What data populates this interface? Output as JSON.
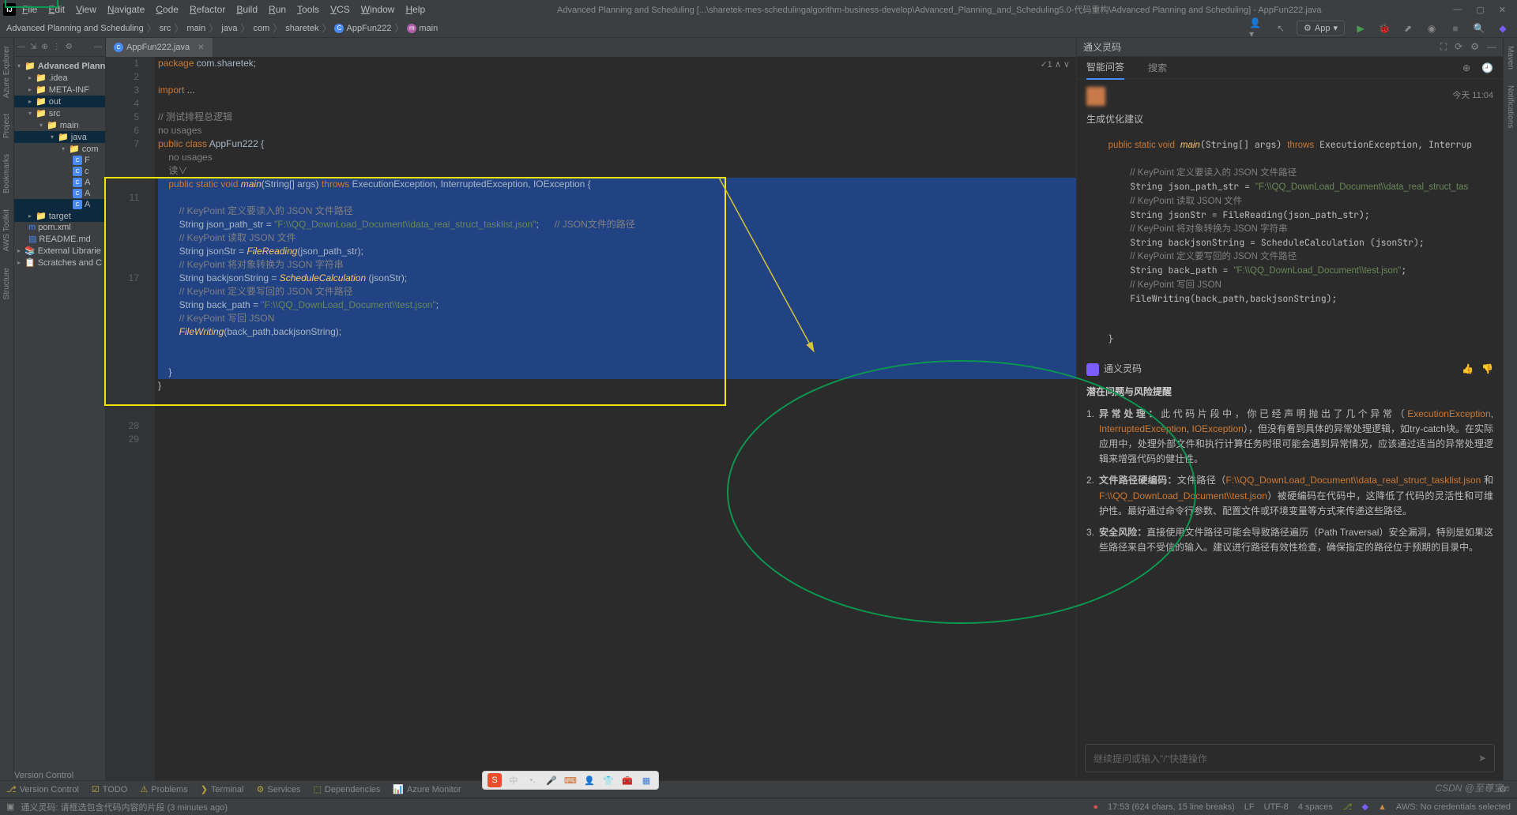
{
  "titlebar": {
    "menu": [
      "File",
      "Edit",
      "View",
      "Navigate",
      "Code",
      "Refactor",
      "Build",
      "Run",
      "Tools",
      "VCS",
      "Window",
      "Help"
    ],
    "title": "Advanced Planning and Scheduling [...\\sharetek-mes-schedulingalgorithm-business-develop\\Advanced_Planning_and_Scheduling5.0-代码重构\\Advanced Planning and Scheduling] - AppFun222.java"
  },
  "breadcrumb": {
    "items": [
      "Advanced Planning and Scheduling",
      "src",
      "main",
      "java",
      "com",
      "sharetek",
      "AppFun222",
      "main"
    ]
  },
  "runconfig": "App",
  "project": {
    "root": "Advanced Plann",
    "items": [
      {
        "l": 1,
        "t": ".idea",
        "k": "folder"
      },
      {
        "l": 1,
        "t": "META-INF",
        "k": "folder"
      },
      {
        "l": 1,
        "t": "out",
        "k": "folder orange",
        "sel": true
      },
      {
        "l": 1,
        "t": "src",
        "k": "folder blue",
        "open": true
      },
      {
        "l": 2,
        "t": "main",
        "k": "folder blue",
        "open": true
      },
      {
        "l": 3,
        "t": "java",
        "k": "folder blue",
        "open": true,
        "sel": true
      },
      {
        "l": 4,
        "t": "com",
        "k": "folder",
        "open": true
      },
      {
        "l": 5,
        "t": "F",
        "k": "file"
      },
      {
        "l": 5,
        "t": "c",
        "k": "file"
      },
      {
        "l": 5,
        "t": "A",
        "k": "file"
      },
      {
        "l": 5,
        "t": "A",
        "k": "file"
      },
      {
        "l": 5,
        "t": "A",
        "k": "file",
        "sel": true
      },
      {
        "l": 1,
        "t": "target",
        "k": "folder orange",
        "sel": true
      },
      {
        "l": 1,
        "t": "pom.xml",
        "k": "pom"
      },
      {
        "l": 1,
        "t": "README.md",
        "k": "md"
      },
      {
        "l": 0,
        "t": "External Librarie",
        "k": "lib"
      },
      {
        "l": 0,
        "t": "Scratches and C",
        "k": "scratch"
      }
    ]
  },
  "tab": {
    "name": "AppFun222.java"
  },
  "code": {
    "topright": "✓1 ∧ ∨",
    "linenums": [
      "1",
      "2",
      "3",
      "4",
      "5",
      "6",
      "7",
      "",
      "",
      "",
      "11",
      "",
      "",
      "",
      "",
      "",
      "17",
      "",
      "",
      "",
      "",
      "",
      "",
      "",
      "",
      "",
      "",
      "28",
      "29"
    ],
    "lines": [
      {
        "html": "<span class='kw'>package</span> <span class='ident'>com.sharetek;</span>"
      },
      {
        "html": ""
      },
      {
        "html": "<span class='kw'>import</span> <span class='ident'>...</span>"
      },
      {
        "html": ""
      },
      {
        "html": "<span class='com'>// 测试排程总逻辑</span>"
      },
      {
        "html": "<span class='com'>no usages</span>"
      },
      {
        "html": "<span class='kw'>public class</span> <span class='ident'>AppFun222 {</span>"
      },
      {
        "html": "    <span class='com'>no usages</span>"
      },
      {
        "html": "    <span class='com'>读∨</span>"
      },
      {
        "sel": true,
        "html": "    <span class='kw'>public static</span> <span class='kw'>void</span> <span class='fn'>main</span>(<span class='ident'>String[] args</span>) <span class='kw'>throws</span> <span class='ident'>ExecutionException, InterruptedException, IOException {</span>"
      },
      {
        "sel": true,
        "html": ""
      },
      {
        "sel": true,
        "html": "        <span class='com'>// KeyPoint 定义要读入的 JSON 文件路径</span>"
      },
      {
        "sel": true,
        "html": "        <span class='ident'>String json_path_str = </span><span class='str'>\"F:\\\\QQ_DownLoad_Document\\\\data_real_struct_tasklist.json\"</span>;      <span class='com'>// JSON文件的路径</span>"
      },
      {
        "sel": true,
        "html": "        <span class='com'>// KeyPoint 读取 JSON 文件</span>"
      },
      {
        "sel": true,
        "html": "        <span class='ident'>String jsonStr = </span><span class='fn'>FileReading</span>(<span class='ident'>json_path_str</span>);"
      },
      {
        "sel": true,
        "html": "        <span class='com'>// KeyPoint 将对象转换为 JSON 字符串</span>"
      },
      {
        "sel": true,
        "html": "        <span class='ident'>String backjsonString = </span><span class='fn'>ScheduleCalculation</span> (<span class='ident'>jsonStr</span>);"
      },
      {
        "sel": true,
        "html": "        <span class='com'>// KeyPoint 定义要写回的 JSON 文件路径</span>"
      },
      {
        "sel": true,
        "html": "        <span class='ident'>String back_path = </span><span class='str'>\"F:\\\\QQ_DownLoad_Document\\\\test.json\"</span>;"
      },
      {
        "sel": true,
        "html": "        <span class='com'>// KeyPoint 写回 JSON</span>"
      },
      {
        "sel": true,
        "html": "        <span class='fn'>FileWriting</span>(<span class='ident'>back_path,backjsonString</span>);"
      },
      {
        "sel": true,
        "html": ""
      },
      {
        "sel": true,
        "html": ""
      },
      {
        "sel": true,
        "html": "    }"
      },
      {
        "html": "}"
      },
      {
        "html": ""
      }
    ]
  },
  "ai": {
    "title": "通义灵码",
    "tabs": [
      "智能问答",
      "搜索"
    ],
    "time": "今天 11:04",
    "userMsg": "生成优化建议",
    "codeBlock": "    <span class='kw'>public static void</span> <span class='fn'>main</span>(String[] args) <span class='kw'>throws</span> ExecutionException, Interrup\n\n        <span class='com'>// KeyPoint 定义要读入的 JSON 文件路径</span>\n        String json_path_str = <span class='str'>\"F:\\\\QQ_DownLoad_Document\\\\data_real_struct_tas</span>\n        <span class='com'>// KeyPoint 读取 JSON 文件</span>\n        String jsonStr = FileReading(json_path_str);\n        <span class='com'>// KeyPoint 将对象转换为 JSON 字符串</span>\n        String backjsonString = ScheduleCalculation (jsonStr);\n        <span class='com'>// KeyPoint 定义要写回的 JSON 文件路径</span>\n        String back_path = <span class='str'>\"F:\\\\QQ_DownLoad_Document\\\\test.json\"</span>;\n        <span class='com'>// KeyPoint 写回 JSON</span>\n        FileWriting(back_path,backjsonString);\n\n\n    }",
    "replyName": "通义灵码",
    "sectionTitle": "潜在问题与风险提醒",
    "risks": [
      {
        "n": "1.",
        "title": "异常处理：",
        "body": "此代码片段中，你已经声明抛出了几个异常（<span class='hl-orange'>ExecutionException</span>, <span class='hl-orange'>InterruptedException</span>, <span class='hl-orange'>IOException</span>），但没有看到具体的异常处理逻辑，如try-catch块。在实际应用中，处理外部文件和执行计算任务时很可能会遇到异常情况，应该通过适当的异常处理逻辑来增强代码的健壮性。"
      },
      {
        "n": "2.",
        "title": "文件路径硬编码：",
        "body": "文件路径（<span class='hl-orange'>F:\\\\QQ_DownLoad_Document\\\\data_real_struct_tasklist.json</span> 和 <span class='hl-orange'>F:\\\\QQ_DownLoad_Document\\\\test.json</span>）被硬编码在代码中，这降低了代码的灵活性和可维护性。最好通过命令行参数、配置文件或环境变量等方式来传递这些路径。"
      },
      {
        "n": "3.",
        "title": "安全风险：",
        "body": "直接使用文件路径可能会导致路径遍历（Path Traversal）安全漏洞，特别是如果这些路径来自不受信的输入。建议进行路径有效性检查，确保指定的路径位于预期的目录中。"
      }
    ],
    "inputPlaceholder": "继续提问或输入\"/\"快捷操作"
  },
  "leftRail": [
    "Azure Explorer",
    "Project",
    "Bookmarks",
    "AWS Toolkit",
    "Structure"
  ],
  "rightRail": [
    "Maven",
    "Notifications"
  ],
  "versionControl": "Version Control",
  "bottomTabs": [
    "Version Control",
    "TODO",
    "Problems",
    "Terminal",
    "Services",
    "Dependencies",
    "Azure Monitor"
  ],
  "statusHint": "通义灵码: 请框选包含代码内容的片段 (3 minutes ago)",
  "statusRight": {
    "cursor": "17:53 (624 chars, 15 line breaks)",
    "enc": "LF",
    "cs": "UTF-8",
    "indent": "4 spaces",
    "aws": "AWS: No credentials selected"
  },
  "watermark": "CSDN @至尊宝♬"
}
